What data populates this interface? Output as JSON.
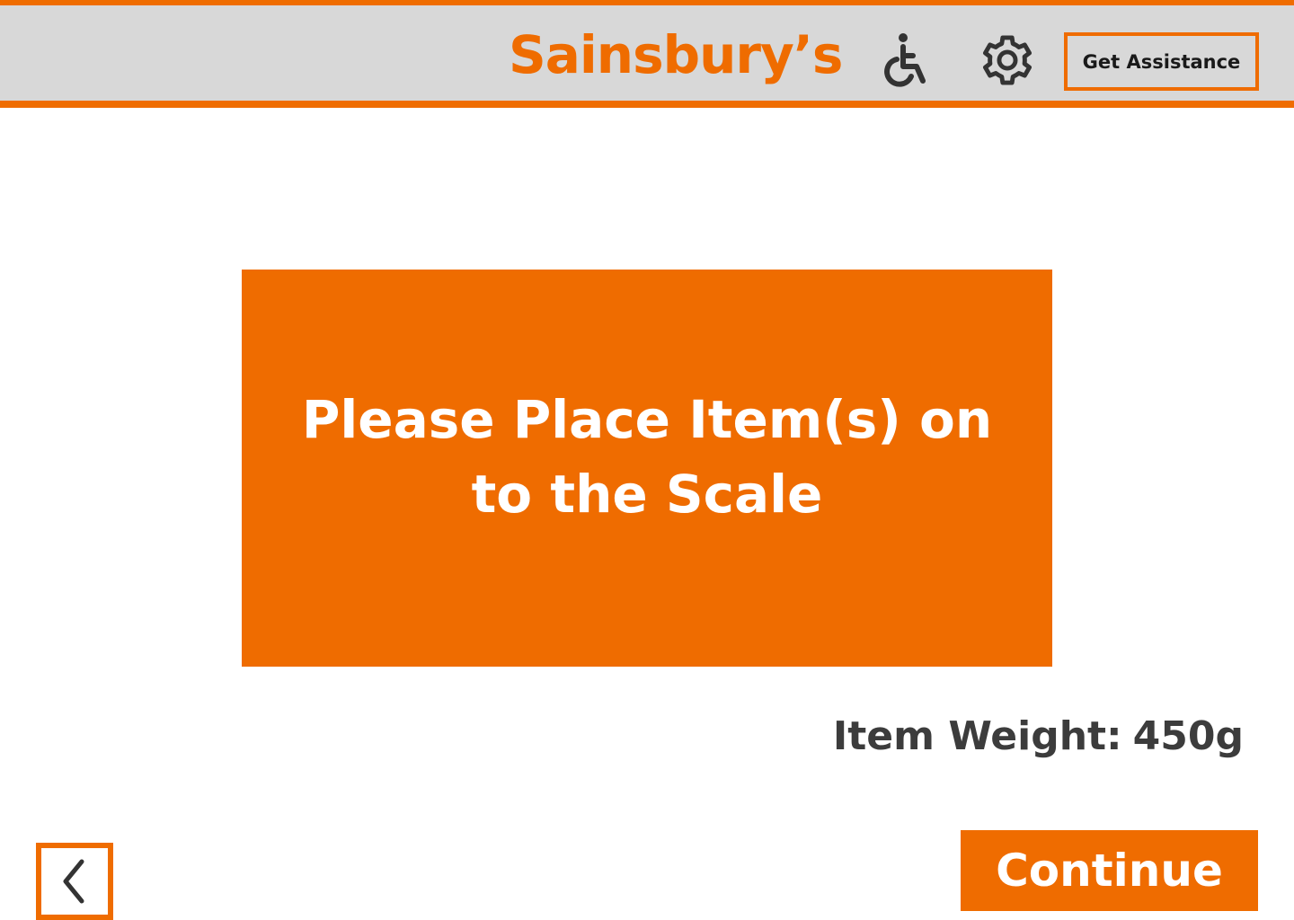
{
  "header": {
    "logo_text": "Sainsbury’s",
    "accessibility_icon": "wheelchair-icon",
    "settings_icon": "gear-icon",
    "assistance_label": "Get Assistance"
  },
  "main": {
    "prompt": "Please Place Item(s) on to the Scale",
    "weight_label": "Item Weight:",
    "weight_value": "450g"
  },
  "footer": {
    "back_icon": "chevron-left-icon",
    "continue_label": "Continue"
  },
  "colors": {
    "brand_orange": "#ef6c00",
    "header_grey": "#d8d8d8",
    "text_dark": "#3c3c3c"
  }
}
